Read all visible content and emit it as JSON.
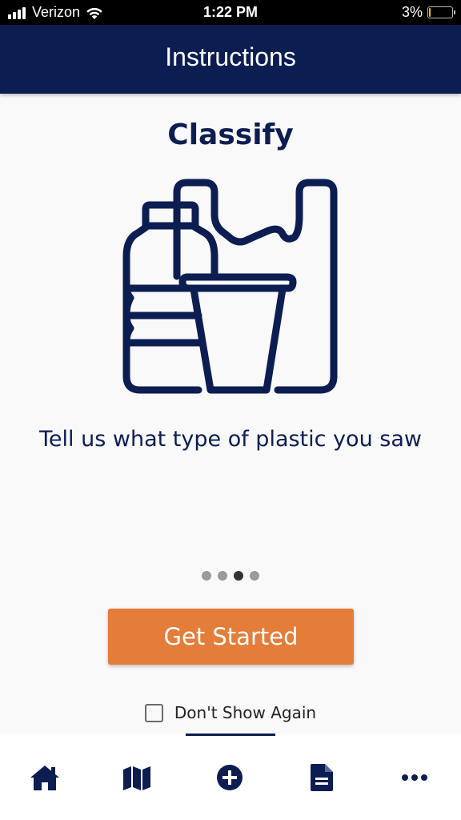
{
  "status_bar": {
    "carrier": "Verizon",
    "time": "1:22 PM",
    "battery_percent": "3%",
    "battery_level": 0.03
  },
  "header": {
    "title": "Instructions"
  },
  "onboarding": {
    "heading": "Classify",
    "illustration_icon": "plastic-items-icon",
    "description": "Tell us what type of plastic you saw",
    "page_count": 4,
    "current_page": 3,
    "cta_label": "Get Started",
    "dont_show_label": "Don't Show Again",
    "dont_show_checked": false
  },
  "tab_bar": {
    "items": [
      {
        "icon": "home-icon"
      },
      {
        "icon": "map-icon"
      },
      {
        "icon": "add-circle-icon"
      },
      {
        "icon": "document-icon"
      },
      {
        "icon": "more-icon"
      }
    ],
    "selected_index": 2
  },
  "colors": {
    "primary": "#0c1d52",
    "accent": "#e37d39",
    "background": "#f9f9fa"
  }
}
